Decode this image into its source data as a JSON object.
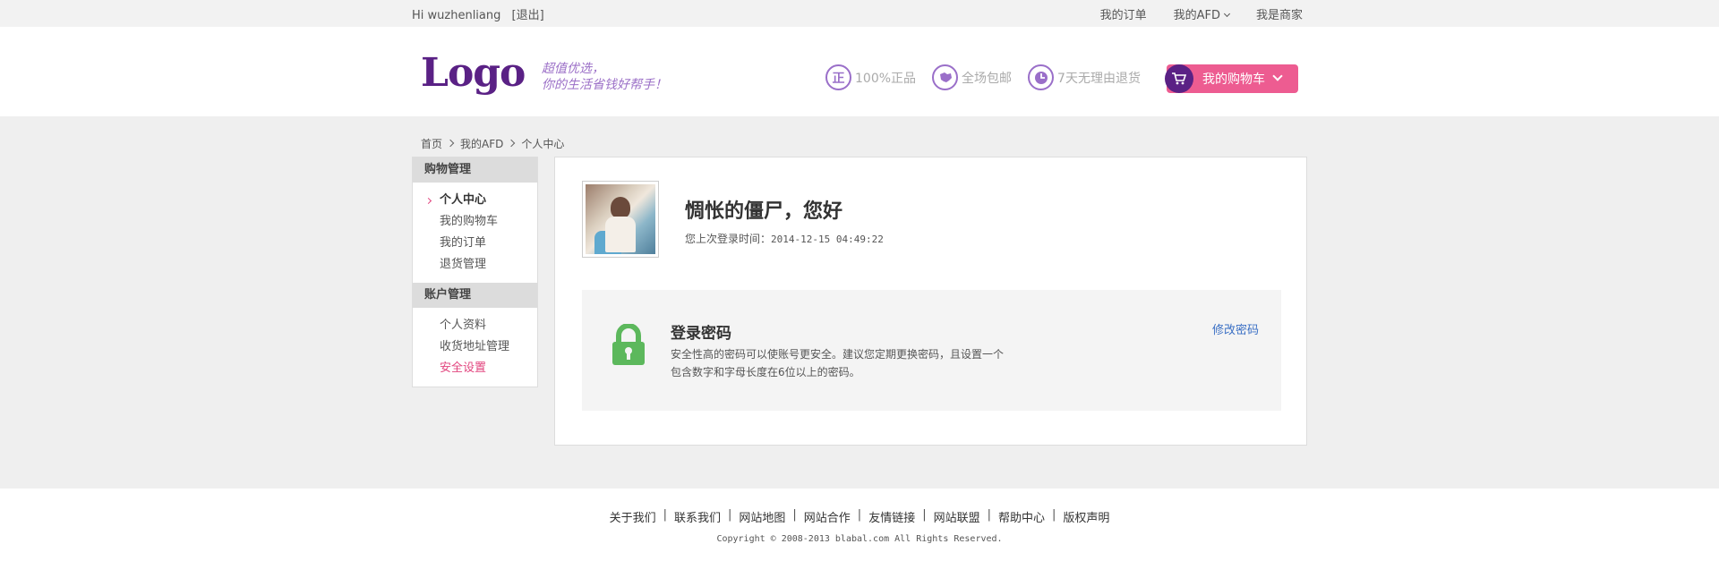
{
  "topbar": {
    "greeting": "Hi wuzhenliang",
    "logout": "[退出]",
    "links": [
      "我的订单",
      "我的AFD",
      "我是商家"
    ]
  },
  "header": {
    "logo": "Logo",
    "slogan_line1": "超值优选，",
    "slogan_line2": "你的生活省钱好帮手！",
    "features": [
      {
        "icon": "zheng-icon",
        "glyph": "正",
        "label": "100%正品"
      },
      {
        "icon": "map-icon",
        "glyph": "",
        "label": "全场包邮"
      },
      {
        "icon": "clock-icon",
        "glyph": "",
        "label": "7天无理由退货"
      }
    ],
    "cart_label": "我的购物车"
  },
  "breadcrumb": [
    "首页",
    "我的AFD",
    "个人中心"
  ],
  "sidebar": {
    "group1": {
      "title": "购物管理",
      "items": [
        "个人中心",
        "我的购物车",
        "我的订单",
        "退货管理"
      ]
    },
    "group2": {
      "title": "账户管理",
      "items": [
        "个人资料",
        "收货地址管理",
        "安全设置"
      ]
    }
  },
  "profile": {
    "greeting": "惆怅的僵尸，您好",
    "last_login_label": "您上次登录时间：",
    "last_login_time": "2014-12-15 04:49:22"
  },
  "password": {
    "title": "登录密码",
    "desc_line1": "安全性高的密码可以使账号更安全。建议您定期更换密码，且设置一个",
    "desc_line2": "包含数字和字母长度在6位以上的密码。",
    "modify_link": "修改密码"
  },
  "footer": {
    "links": [
      "关于我们",
      "联系我们",
      "网站地图",
      "网站合作",
      "友情链接",
      "网站联盟",
      "帮助中心",
      "版权声明"
    ],
    "copyright": "Copyright © 2008-2013 blabal.com All Rights Reserved."
  },
  "colors": {
    "brand_purple": "#5a2185",
    "accent_pink": "#ed5c91",
    "link_blue": "#3a6fc4",
    "lock_green": "#5cb85c"
  }
}
